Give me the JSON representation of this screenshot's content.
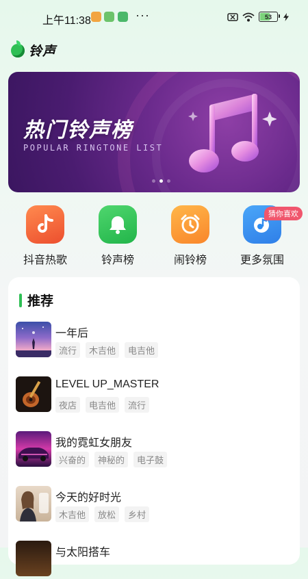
{
  "status": {
    "time": "上午11:38",
    "battery": "53",
    "app_icon_colors": [
      "#f2a541",
      "#6cc36a",
      "#4bb86a"
    ]
  },
  "header": {
    "title": "铃声"
  },
  "banner": {
    "headline": "热门铃声榜",
    "subtitle": "POPULAR RINGTONE LIST",
    "page_count": 3,
    "active_page": 2
  },
  "categories": [
    {
      "label": "抖音热歌",
      "icon": "tiktok-icon",
      "color": "#f06a3b"
    },
    {
      "label": "铃声榜",
      "icon": "bell-icon",
      "color": "#35c65a"
    },
    {
      "label": "闹铃榜",
      "icon": "alarm-clock-icon",
      "color": "#fb9a2f"
    },
    {
      "label": "更多氛围",
      "icon": "music-note-icon",
      "color": "#2f8cf0",
      "badge": "猜你喜欢"
    }
  ],
  "recommend": {
    "title": "推荐",
    "songs": [
      {
        "name": "一年后",
        "tags": [
          "流行",
          "木吉他",
          "电吉他"
        ]
      },
      {
        "name": "LEVEL UP_MASTER",
        "tags": [
          "夜店",
          "电吉他",
          "流行"
        ]
      },
      {
        "name": "我的霓虹女朋友",
        "tags": [
          "兴奋的",
          "神秘的",
          "电子鼓"
        ]
      },
      {
        "name": "今天的好时光",
        "tags": [
          "木吉他",
          "放松",
          "乡村"
        ]
      },
      {
        "name": "与太阳搭车",
        "tags": []
      }
    ]
  }
}
